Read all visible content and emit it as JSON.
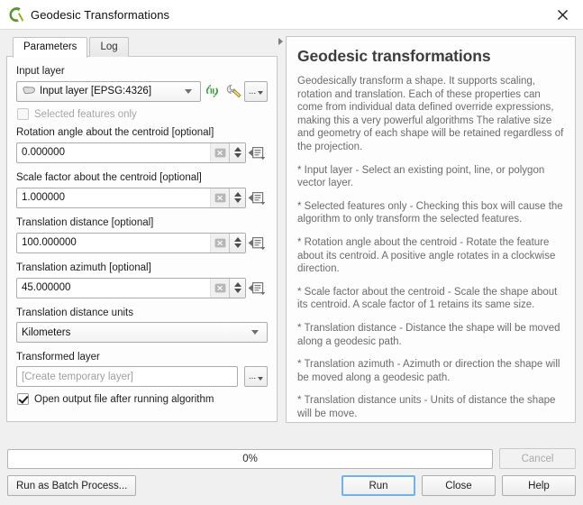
{
  "window": {
    "title": "Geodesic Transformations",
    "app_icon": "qgis-logo-icon",
    "close_icon": "close-icon"
  },
  "tabs": [
    {
      "label": "Parameters",
      "active": true
    },
    {
      "label": "Log",
      "active": false
    }
  ],
  "parameters": {
    "input_layer": {
      "label": "Input layer",
      "value": "Input layer [EPSG:4326]",
      "layer_icon": "polygon-layer-icon",
      "iterate_icon": "iterate-over-features-icon",
      "advanced_icon": "wrench-icon",
      "browse_label": "..."
    },
    "selected_features_only": {
      "label": "Selected features only",
      "checked": false,
      "enabled": false
    },
    "rotation_angle": {
      "label": "Rotation angle about the centroid [optional]",
      "value": "0.000000",
      "clear_icon": "clear-value-icon",
      "override_icon": "data-defined-override-icon"
    },
    "scale_factor": {
      "label": "Scale factor about the centroid [optional]",
      "value": "1.000000",
      "clear_icon": "clear-value-icon",
      "override_icon": "data-defined-override-icon"
    },
    "translation_distance": {
      "label": "Translation distance [optional]",
      "value": "100.000000",
      "clear_icon": "clear-value-icon",
      "override_icon": "data-defined-override-icon"
    },
    "translation_azimuth": {
      "label": "Translation azimuth [optional]",
      "value": "45.000000",
      "clear_icon": "clear-value-icon",
      "override_icon": "data-defined-override-icon"
    },
    "translation_distance_units": {
      "label": "Translation distance units",
      "value": "Kilometers"
    },
    "transformed_layer": {
      "label": "Transformed layer",
      "placeholder": "[Create temporary layer]",
      "value": "",
      "browse_label": "..."
    },
    "open_output": {
      "label": "Open output file after running algorithm",
      "checked": true
    }
  },
  "help": {
    "title": "Geodesic transformations",
    "paragraphs": [
      "Geodesically transform a shape. It supports scaling, rotation and translation. Each of these properties can come from individual data defined override expressions, making this a very powerful algorithms The ralative size and geometry of each shape will be retained regardless of the projection.",
      "* Input layer - Select an existing point, line, or polygon vector layer.",
      "* Selected features only - Checking this box will cause the algorithm to only transform the selected features.",
      "* Rotation angle about the centroid - Rotate the feature about its centroid. A positive angle rotates in a clockwise direction.",
      "* Scale factor about the centroid - Scale the shape about its centroid. A scale factor of 1 retains its same size.",
      "* Translation distance - Distance the shape will be moved along a geodesic path.",
      "* Translation azimuth - Azimuth or direction the shape will be moved along a geodesic path.",
      "* Translation distance units - Units of distance the shape will be move."
    ]
  },
  "splitter": {
    "collapse_icon": "splitter-collapse-icon"
  },
  "footer": {
    "progress_text": "0%",
    "progress_percent": 0,
    "cancel_label": "Cancel",
    "cancel_enabled": false,
    "run_batch_label": "Run as Batch Process...",
    "run_label": "Run",
    "close_label": "Close",
    "help_label": "Help"
  },
  "colors": {
    "accent": "#6fb4e6",
    "qgis_green": "#589632",
    "panel_bg": "#fdfdfd",
    "dialog_bg": "#f0f0f0",
    "help_text": "#6b6b6b"
  }
}
